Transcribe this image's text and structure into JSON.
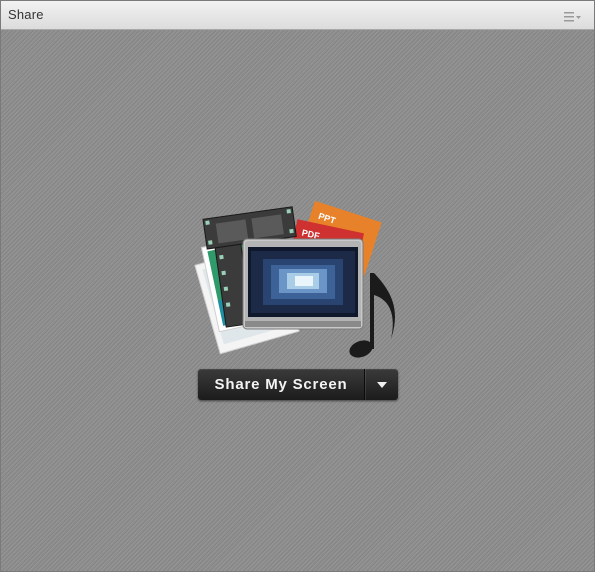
{
  "pod": {
    "title": "Share",
    "menu_icon": "menu-lines-dropdown-icon"
  },
  "hero": {
    "icon": "share-content-collage-icon",
    "doc_labels": [
      "PPT",
      "PDF"
    ]
  },
  "share_button": {
    "label": "Share My Screen",
    "dropdown_icon": "caret-down-icon"
  },
  "colors": {
    "background": "#8d8d8d",
    "titlebar": "#e6e6e6",
    "button": "#262626",
    "button_text": "#f4f4f4",
    "ppt": "#e8822a",
    "pdf": "#cf3030"
  }
}
